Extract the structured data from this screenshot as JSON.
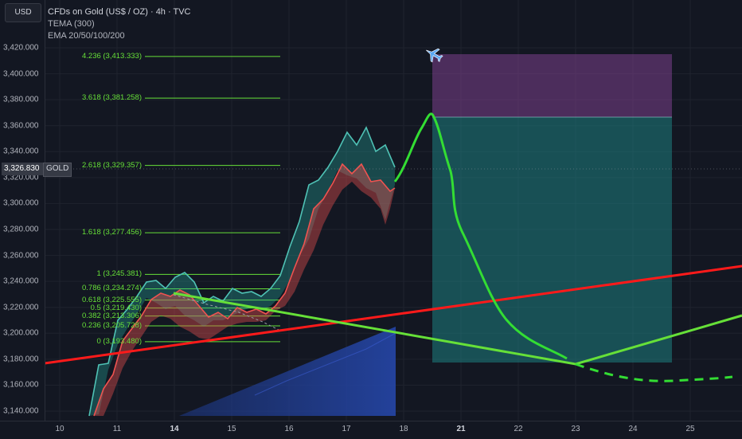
{
  "header": {
    "currency_button": "USD",
    "symbol_title": "CFDs on Gold (US$ / OZ) · 4h · TVC",
    "indicators": [
      "TEMA (300)",
      "EMA 20/50/100/200"
    ]
  },
  "price_tag": {
    "value": "3,326.830",
    "symbol": "GOLD"
  },
  "y_axis": {
    "min": 3130,
    "max": 3425,
    "labels": [
      "3,420.000",
      "3,400.000",
      "3,380.000",
      "3,360.000",
      "3,340.000",
      "3,320.000",
      "3,300.000",
      "3,280.000",
      "3,260.000",
      "3,240.000",
      "3,220.000",
      "3,200.000",
      "3,180.000",
      "3,160.000",
      "3,140.000"
    ]
  },
  "x_axis": {
    "labels": [
      {
        "text": "10",
        "bold": false
      },
      {
        "text": "11",
        "bold": false
      },
      {
        "text": "14",
        "bold": true
      },
      {
        "text": "15",
        "bold": false
      },
      {
        "text": "16",
        "bold": false
      },
      {
        "text": "17",
        "bold": false
      },
      {
        "text": "18",
        "bold": false
      },
      {
        "text": "21",
        "bold": true
      },
      {
        "text": "22",
        "bold": false
      },
      {
        "text": "23",
        "bold": false
      },
      {
        "text": "24",
        "bold": false
      },
      {
        "text": "25",
        "bold": false
      }
    ]
  },
  "fibonacci": [
    {
      "label": "4.236 (3,413.333)",
      "price": 3413.333
    },
    {
      "label": "3.618 (3,381.258)",
      "price": 3381.258
    },
    {
      "label": "2.618 (3,329.357)",
      "price": 3329.357
    },
    {
      "label": "1.618 (3,277.456)",
      "price": 3277.456
    },
    {
      "label": "1 (3,245.381)",
      "price": 3245.381
    },
    {
      "label": "0.786 (3,234.274)",
      "price": 3234.274
    },
    {
      "label": "0.618 (3,225.555)",
      "price": 3225.555
    },
    {
      "label": "0.5 (3,219.430)",
      "price": 3219.43
    },
    {
      "label": "0.382 (3,213.306)",
      "price": 3213.306
    },
    {
      "label": "0.236 (3,205.728)",
      "price": 3205.728
    },
    {
      "label": "0 (3,193.480)",
      "price": 3193.48
    }
  ],
  "colors": {
    "background": "#131722",
    "fib": "#66e038",
    "band_up": "#26a69a",
    "band_down": "#ef5350",
    "trend_red": "#ff1a1a",
    "trend_green": "#66e038",
    "projection": "#33dd33",
    "target_zone": "#7b3f8c",
    "stop_zone": "#1d7f80",
    "volume_profile": "#1e3a8a"
  },
  "icons": {
    "target_marker": "airplane-icon"
  }
}
